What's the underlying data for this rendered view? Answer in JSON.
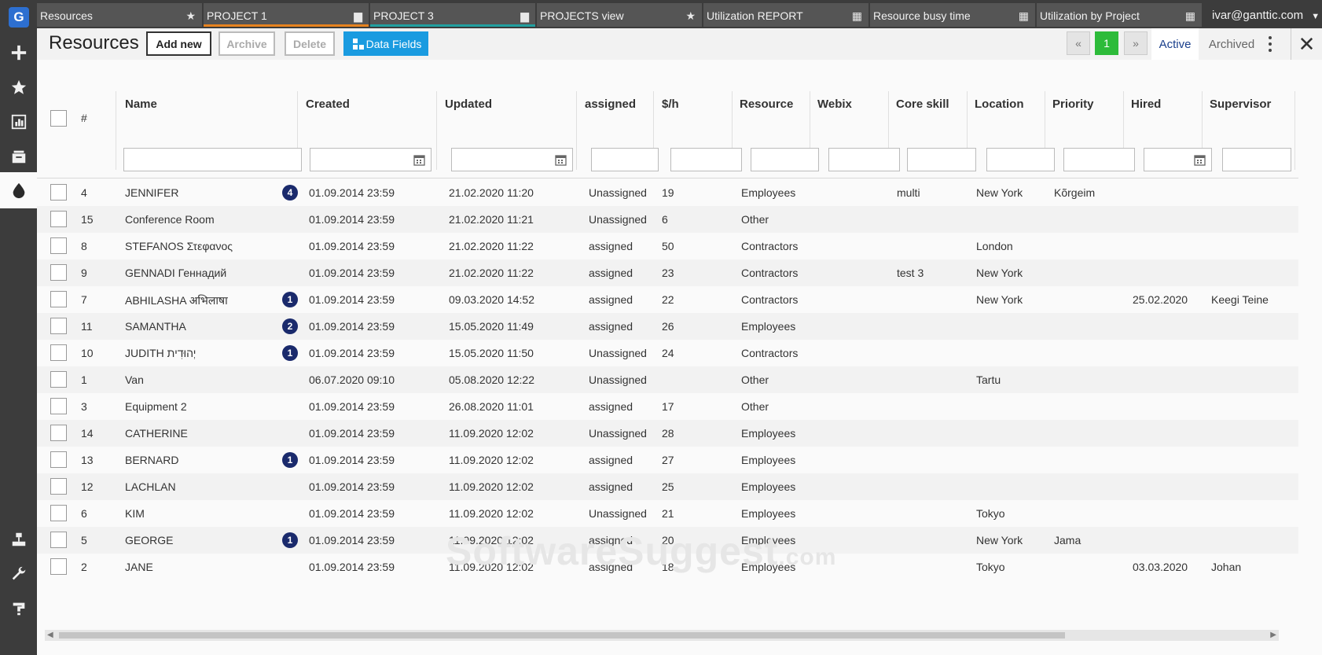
{
  "app": {
    "logo": "G",
    "sidebar_icons": [
      "plus-icon",
      "star-icon",
      "chart-icon",
      "folders-icon",
      "drop-icon",
      "sitemap-icon",
      "wrench-icon",
      "help-icon"
    ]
  },
  "tabs": [
    {
      "label": "Resources",
      "icon": "★"
    },
    {
      "label": "PROJECT 1",
      "icon": "▆"
    },
    {
      "label": "PROJECT 3",
      "icon": "▆"
    },
    {
      "label": "PROJECTS view",
      "icon": "★"
    },
    {
      "label": "Utilization REPORT",
      "icon": "▦"
    },
    {
      "label": "Resource busy time",
      "icon": "▦"
    },
    {
      "label": "Utilization by Project",
      "icon": "▦"
    }
  ],
  "user": {
    "email": "ivar@ganttic.com",
    "caret": "▼"
  },
  "toolbar": {
    "title": "Resources",
    "add_new": "Add new",
    "archive": "Archive",
    "delete": "Delete",
    "data_fields": "Data Fields",
    "pager_first": "«",
    "pager_page": "1",
    "pager_last": "»",
    "view_active": "Active",
    "view_archived": "Archived",
    "close": "✕"
  },
  "grid": {
    "columns": [
      "#",
      "Name",
      "Created",
      "Updated",
      "assigned",
      "$/h",
      "Resource",
      "Webix",
      "Core skill",
      "Location",
      "Priority",
      "Hired",
      "Supervisor"
    ],
    "rows": [
      {
        "id": "4",
        "name": "JENNIFER",
        "badge": "4",
        "created": "01.09.2014 23:59",
        "updated": "21.02.2020 11:20",
        "assigned": "Unassigned",
        "rate": "19",
        "resource": "Employees",
        "webix": "",
        "skill": "multi",
        "location": "New York",
        "priority": "Kõrgeim",
        "hired": "",
        "supervisor": ""
      },
      {
        "id": "15",
        "name": "Conference Room",
        "badge": "",
        "created": "01.09.2014 23:59",
        "updated": "21.02.2020 11:21",
        "assigned": "Unassigned",
        "rate": "6",
        "resource": "Other",
        "webix": "",
        "skill": "",
        "location": "",
        "priority": "",
        "hired": "",
        "supervisor": ""
      },
      {
        "id": "8",
        "name": "STEFANOS Στεφανος",
        "badge": "",
        "created": "01.09.2014 23:59",
        "updated": "21.02.2020 11:22",
        "assigned": "assigned",
        "rate": "50",
        "resource": "Contractors",
        "webix": "",
        "skill": "",
        "location": "London",
        "priority": "",
        "hired": "",
        "supervisor": ""
      },
      {
        "id": "9",
        "name": "GENNADI Геннадий",
        "badge": "",
        "created": "01.09.2014 23:59",
        "updated": "21.02.2020 11:22",
        "assigned": "assigned",
        "rate": "23",
        "resource": "Contractors",
        "webix": "",
        "skill": "test 3",
        "location": "New York",
        "priority": "",
        "hired": "",
        "supervisor": ""
      },
      {
        "id": "7",
        "name": "ABHILASHA अभिलाषा",
        "badge": "1",
        "created": "01.09.2014 23:59",
        "updated": "09.03.2020 14:52",
        "assigned": "assigned",
        "rate": "22",
        "resource": "Contractors",
        "webix": "",
        "skill": "",
        "location": "New York",
        "priority": "",
        "hired": "25.02.2020",
        "supervisor": "Keegi Teine"
      },
      {
        "id": "11",
        "name": "SAMANTHA",
        "badge": "2",
        "created": "01.09.2014 23:59",
        "updated": "15.05.2020 11:49",
        "assigned": "assigned",
        "rate": "26",
        "resource": "Employees",
        "webix": "",
        "skill": "",
        "location": "",
        "priority": "",
        "hired": "",
        "supervisor": ""
      },
      {
        "id": "10",
        "name": "JUDITH יְהוּדִית",
        "badge": "1",
        "created": "01.09.2014 23:59",
        "updated": "15.05.2020 11:50",
        "assigned": "Unassigned",
        "rate": "24",
        "resource": "Contractors",
        "webix": "",
        "skill": "",
        "location": "",
        "priority": "",
        "hired": "",
        "supervisor": ""
      },
      {
        "id": "1",
        "name": "Van",
        "badge": "",
        "created": "06.07.2020 09:10",
        "updated": "05.08.2020 12:22",
        "assigned": "Unassigned",
        "rate": "",
        "resource": "Other",
        "webix": "",
        "skill": "",
        "location": "Tartu",
        "priority": "",
        "hired": "",
        "supervisor": ""
      },
      {
        "id": "3",
        "name": "Equipment 2",
        "badge": "",
        "created": "01.09.2014 23:59",
        "updated": "26.08.2020 11:01",
        "assigned": "assigned",
        "rate": "17",
        "resource": "Other",
        "webix": "",
        "skill": "",
        "location": "",
        "priority": "",
        "hired": "",
        "supervisor": ""
      },
      {
        "id": "14",
        "name": "CATHERINE",
        "badge": "",
        "created": "01.09.2014 23:59",
        "updated": "11.09.2020 12:02",
        "assigned": "Unassigned",
        "rate": "28",
        "resource": "Employees",
        "webix": "",
        "skill": "",
        "location": "",
        "priority": "",
        "hired": "",
        "supervisor": ""
      },
      {
        "id": "13",
        "name": "BERNARD",
        "badge": "1",
        "created": "01.09.2014 23:59",
        "updated": "11.09.2020 12:02",
        "assigned": "assigned",
        "rate": "27",
        "resource": "Employees",
        "webix": "",
        "skill": "",
        "location": "",
        "priority": "",
        "hired": "",
        "supervisor": ""
      },
      {
        "id": "12",
        "name": "LACHLAN",
        "badge": "",
        "created": "01.09.2014 23:59",
        "updated": "11.09.2020 12:02",
        "assigned": "assigned",
        "rate": "25",
        "resource": "Employees",
        "webix": "",
        "skill": "",
        "location": "",
        "priority": "",
        "hired": "",
        "supervisor": ""
      },
      {
        "id": "6",
        "name": "KIM",
        "badge": "",
        "created": "01.09.2014 23:59",
        "updated": "11.09.2020 12:02",
        "assigned": "Unassigned",
        "rate": "21",
        "resource": "Employees",
        "webix": "",
        "skill": "",
        "location": "Tokyo",
        "priority": "",
        "hired": "",
        "supervisor": ""
      },
      {
        "id": "5",
        "name": "GEORGE",
        "badge": "1",
        "created": "01.09.2014 23:59",
        "updated": "11.09.2020 12:02",
        "assigned": "assigned",
        "rate": "20",
        "resource": "Employees",
        "webix": "",
        "skill": "",
        "location": "New York",
        "priority": "Jama",
        "hired": "",
        "supervisor": ""
      },
      {
        "id": "2",
        "name": "JANE",
        "badge": "",
        "created": "01.09.2014 23:59",
        "updated": "11.09.2020 12:02",
        "assigned": "assigned",
        "rate": "18",
        "resource": "Employees",
        "webix": "",
        "skill": "",
        "location": "Tokyo",
        "priority": "",
        "hired": "03.03.2020",
        "supervisor": "Johan"
      }
    ]
  },
  "watermark": {
    "main": "SoftwareSuggest",
    "suffix": ".com"
  },
  "colors": {
    "accent_blue": "#1a9be0",
    "pager_green": "#2dbb3a",
    "badge_navy": "#1a2a6c",
    "tab_orange": "#e7831f",
    "tab_teal": "#21a0a0"
  }
}
